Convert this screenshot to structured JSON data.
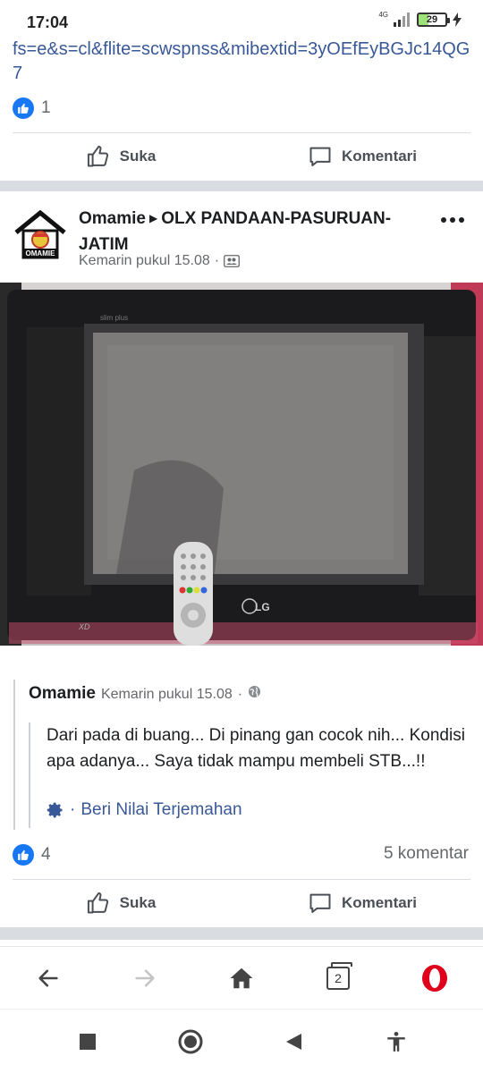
{
  "status_bar": {
    "time": "17:04",
    "network": "4G",
    "battery": "29"
  },
  "prev_post": {
    "link_text": "fs=e&s=cl&flite=scwspnss&mibextid=3yOEfEyBGJc14QG7",
    "like_count": "1",
    "actions": {
      "like": "Suka",
      "comment": "Komentari"
    }
  },
  "post": {
    "author": "Omamie",
    "group": "OLX PANDAAN-PASURUAN-JATIM",
    "timestamp": "Kemarin pukul 15.08",
    "avatar_label": "OMAMIE",
    "photo_brand": "LG",
    "photo_tag": "XD",
    "photo_small_text": "slim plus",
    "comment": {
      "author": "Omamie",
      "timestamp": "Kemarin pukul 15.08",
      "text": "Dari pada di buang... Di pinang gan cocok nih... Kondisi apa adanya... Saya tidak mampu membeli STB...!!",
      "translate_label": "Beri Nilai Terjemahan"
    },
    "like_count": "4",
    "comment_count": "5 komentar",
    "actions": {
      "like": "Suka",
      "comment": "Komentari"
    }
  },
  "browser_bar": {
    "tab_count": "2",
    "icons": [
      "back-arrow-icon",
      "forward-arrow-icon",
      "home-icon",
      "tabs-icon",
      "opera-icon"
    ]
  },
  "system_nav": {
    "icons": [
      "recents-square-icon",
      "home-circle-icon",
      "back-triangle-icon",
      "accessibility-icon"
    ]
  },
  "colors": {
    "facebook_blue": "#1877f2",
    "link_blue": "#385898",
    "meta_grey": "#65676b",
    "separator": "#d9dce1",
    "opera_red": "#e0001b"
  }
}
